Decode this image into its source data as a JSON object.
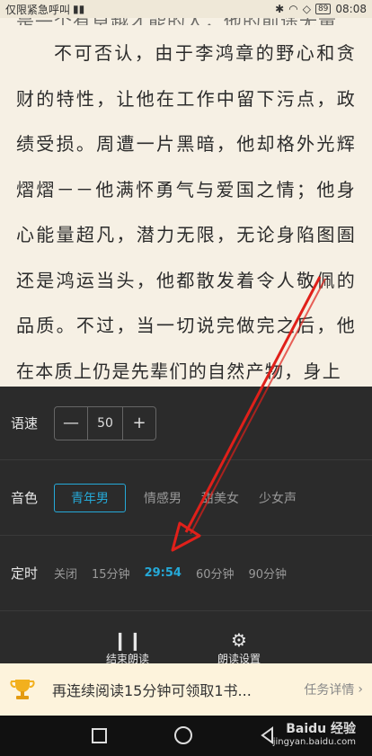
{
  "status_bar": {
    "carrier": "仅限紧急呼叫",
    "battery": "89",
    "time": "08:08"
  },
  "reader": {
    "cut_line": "是一个有卓越才能的人，他的前途无量",
    "paragraph": "不可否认，由于李鸿章的野心和贪财的特性，让他在工作中留下污点，政绩受损。周遭一片黑暗，他却格外光辉熠熠－－他满怀勇气与爱国之情；他身心能量超凡，潜力无限，无论身陷图圄还是鸿运当头，他都散发着令人敬佩的品质。不过，当一切说完做完之后，他在本质上仍是先辈们的自然产物，身上"
  },
  "panel": {
    "speed": {
      "label": "语速",
      "minus": "—",
      "value": "50",
      "plus": "+"
    },
    "voice": {
      "label": "音色",
      "options": [
        "青年男",
        "情感男",
        "甜美女",
        "少女声"
      ],
      "selected": "青年男"
    },
    "timer": {
      "label": "定时",
      "options": [
        "关闭",
        "15分钟",
        "29:54",
        "60分钟",
        "90分钟"
      ],
      "selected": "29:54"
    },
    "actions": {
      "stop_label": "结束朗读",
      "settings_label": "朗读设置"
    }
  },
  "banner": {
    "text": "再连续阅读15分钟可领取1书...",
    "link": "任务详情"
  },
  "watermark": {
    "brand": "Baidu 经验",
    "url": "jingyan.baidu.com"
  },
  "colors": {
    "accent": "#25a9d8",
    "panel_bg": "#2b2b2b",
    "page_bg": "#f6f0e4",
    "arrow": "#e0201a"
  }
}
